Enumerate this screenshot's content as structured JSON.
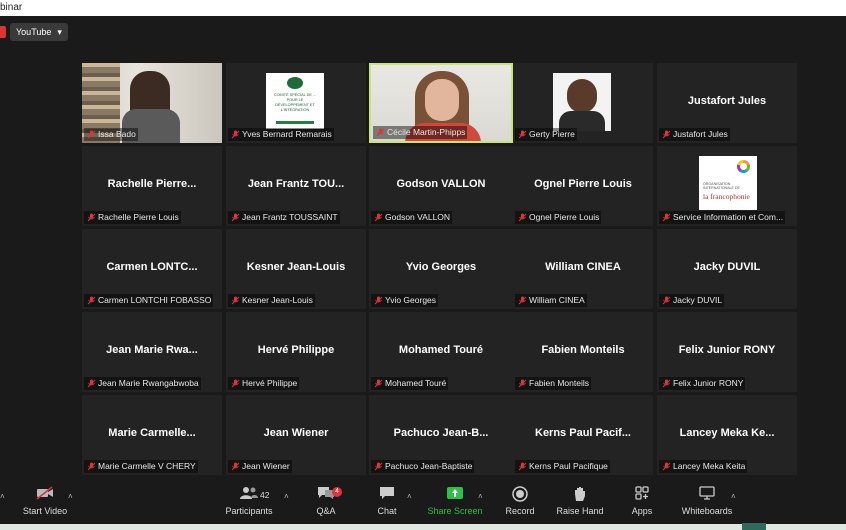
{
  "window": {
    "title": "binar"
  },
  "topbar": {
    "live_source": "YouTube",
    "caret": "▾"
  },
  "participants": [
    {
      "name": "Issa Bado",
      "display": "",
      "video": "photo-a"
    },
    {
      "name": "Yves Bernard Remarais",
      "display": "",
      "video": "logo"
    },
    {
      "name": "Cécile Martin-Phipps",
      "display": "",
      "video": "photo-b",
      "active": true
    },
    {
      "name": "Gerty Pierre",
      "display": "",
      "video": "photo-c"
    },
    {
      "name": "Justafort Jules",
      "display": "Justafort Jules"
    },
    {
      "name": "Rachelle Pierre Louis",
      "display": "Rachelle  Pierre..."
    },
    {
      "name": "Jean Frantz TOUSSAINT",
      "display": "Jean Frantz TOU..."
    },
    {
      "name": "Godson VALLON",
      "display": "Godson VALLON"
    },
    {
      "name": "Ognel Pierre Louis",
      "display": "Ognel Pierre Louis"
    },
    {
      "name": "Service Information et Com...",
      "display": "",
      "video": "francophonie"
    },
    {
      "name": "Carmen LONTCHI FOBASSO",
      "display": "Carmen  LONTC..."
    },
    {
      "name": "Kesner Jean-Louis",
      "display": "Kesner Jean-Louis"
    },
    {
      "name": "Yvio Georges",
      "display": "Yvio Georges"
    },
    {
      "name": "William CINEA",
      "display": "William CINEA"
    },
    {
      "name": "Jacky DUVIL",
      "display": "Jacky DUVIL"
    },
    {
      "name": "Jean Marie Rwangabwoba",
      "display": "Jean Marie Rwa..."
    },
    {
      "name": "Hervé Philippe",
      "display": "Hervé Philippe"
    },
    {
      "name": "Mohamed Touré",
      "display": "Mohamed Touré"
    },
    {
      "name": "Fabien Monteils",
      "display": "Fabien Monteils"
    },
    {
      "name": "Felix Junior RONY",
      "display": "Felix Junior RONY"
    },
    {
      "name": "Marie Carmelle V CHERY",
      "display": "Marie  Carmelle..."
    },
    {
      "name": "Jean Wiener",
      "display": "Jean Wiener"
    },
    {
      "name": "Pachuco Jean-Baptiste",
      "display": "Pachuco  Jean-B..."
    },
    {
      "name": "Kerns Paul Pacifique",
      "display": "Kerns  Paul  Pacif..."
    },
    {
      "name": "Lancey Meka Keita",
      "display": "Lancey Meka Ke..."
    }
  ],
  "logo_text": "COMITÉ SPÉCIAL DE ... POUR LE DÉVELOPPEMENT ET L'INTÉGRATION",
  "francophonie": {
    "line1": "ORGANISATION INTERNATIONALE DE",
    "line2": "la francophonie"
  },
  "toolbar": {
    "start_video": "Start Video",
    "participants": "Participants",
    "participants_count": "42",
    "qa": "Q&A",
    "qa_badge": "4",
    "chat": "Chat",
    "share": "Share Screen",
    "record": "Record",
    "raise": "Raise Hand",
    "apps": "Apps",
    "whiteboards": "Whiteboards"
  },
  "colors": {
    "active_border": "#c7e67a",
    "share_green": "#2fbf4a",
    "muted_red": "#d9363e"
  }
}
